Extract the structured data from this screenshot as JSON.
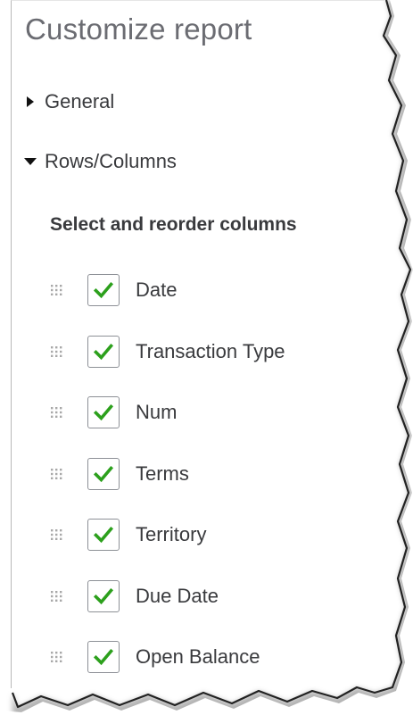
{
  "panel": {
    "title": "Customize report"
  },
  "sections": {
    "general": {
      "label": "General",
      "expanded": false
    },
    "rows_columns": {
      "label": "Rows/Columns",
      "expanded": true
    }
  },
  "columns": {
    "heading": "Select and reorder columns",
    "items": [
      {
        "label": "Date",
        "checked": true
      },
      {
        "label": "Transaction Type",
        "checked": true
      },
      {
        "label": "Num",
        "checked": true
      },
      {
        "label": "Terms",
        "checked": true
      },
      {
        "label": "Territory",
        "checked": true
      },
      {
        "label": "Due Date",
        "checked": true
      },
      {
        "label": "Open Balance",
        "checked": true
      }
    ]
  },
  "colors": {
    "check": "#2ca01c",
    "text": "#393a3d",
    "title": "#6b6c72"
  }
}
